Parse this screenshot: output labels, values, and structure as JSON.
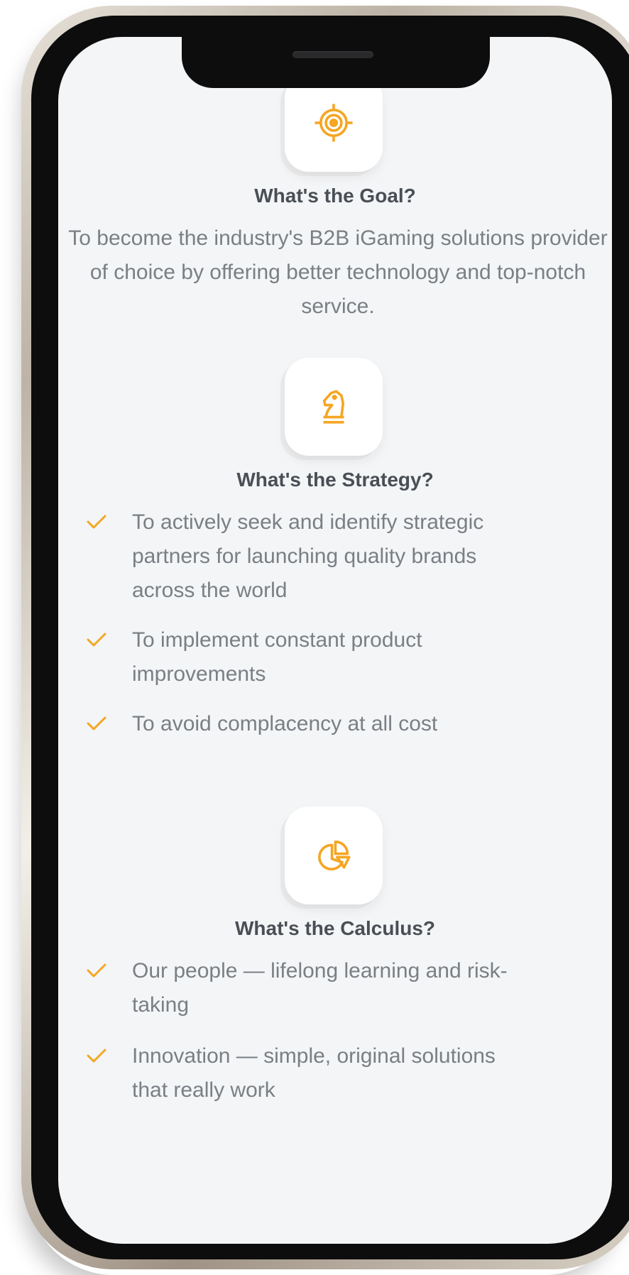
{
  "colors": {
    "accent": "#f5a623",
    "heading": "#4a4f55",
    "body_text": "#7a7f84",
    "screen_bg": "#f3f5f7"
  },
  "goal": {
    "icon": "target-icon",
    "title": "What's the Goal?",
    "text": "To become the industry's B2B iGaming solutions provider of choice by offering better technology and top-notch service."
  },
  "strategy": {
    "icon": "chess-knight-icon",
    "title": "What's the Strategy?",
    "items": [
      "To actively seek and identify strategic partners for launching quality brands across the world",
      "To implement constant product improvements",
      "To avoid complacency at all cost"
    ]
  },
  "calculus": {
    "icon": "pie-chart-icon",
    "title": "What's the Calculus?",
    "items": [
      "Our people — lifelong learning and risk-taking",
      "Innovation — simple, original solutions that really work"
    ]
  }
}
